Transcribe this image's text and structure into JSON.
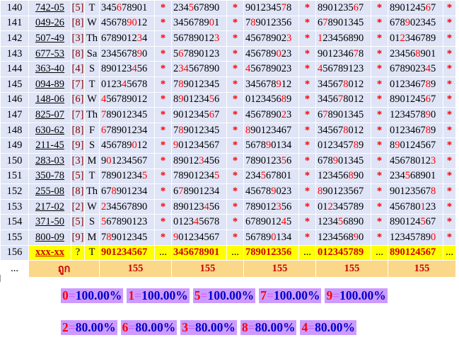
{
  "rows": [
    {
      "num": "140",
      "code": "742-05",
      "digit": "[5]",
      "day": "T",
      "cols": [
        "345678901",
        "234567890",
        "901234578",
        "890123567",
        "890124567"
      ]
    },
    {
      "num": "141",
      "code": "049-26",
      "digit": "[8]",
      "day": "W",
      "cols": [
        "456789012",
        "345678901",
        "789012356",
        "678901345",
        "678902345"
      ]
    },
    {
      "num": "142",
      "code": "507-49",
      "digit": "[3]",
      "day": "Th",
      "cols": [
        "678901234",
        "567890123",
        "456789023",
        "123456890",
        "012346789"
      ]
    },
    {
      "num": "143",
      "code": "677-53",
      "digit": "[8]",
      "day": "Sa",
      "cols": [
        "234567890",
        "567890123",
        "456789023",
        "901234678",
        "234568901"
      ]
    },
    {
      "num": "144",
      "code": "363-40",
      "digit": "[4]",
      "day": "S",
      "cols": [
        "890123456",
        "234567890",
        "456789023",
        "456789123",
        "678902345"
      ]
    },
    {
      "num": "145",
      "code": "094-89",
      "digit": "[7]",
      "day": "T",
      "cols": [
        "012345678",
        "789012345",
        "345678912",
        "345678012",
        "012346789"
      ]
    },
    {
      "num": "146",
      "code": "148-06",
      "digit": "[6]",
      "day": "W",
      "cols": [
        "456789012",
        "890123456",
        "012345689",
        "345678012",
        "890124567"
      ]
    },
    {
      "num": "147",
      "code": "825-07",
      "digit": "[7]",
      "day": "Th",
      "cols": [
        "789012345",
        "901234567",
        "456789023",
        "678901345",
        "123457890"
      ]
    },
    {
      "num": "148",
      "code": "630-62",
      "digit": "[8]",
      "day": "F",
      "cols": [
        "678901234",
        "789012345",
        "890123467",
        "345678012",
        "012346789"
      ]
    },
    {
      "num": "149",
      "code": "211-45",
      "digit": "[9]",
      "day": "S",
      "cols": [
        "456789012",
        "901234567",
        "567890134",
        "012345789",
        "890124567"
      ]
    },
    {
      "num": "150",
      "code": "283-03",
      "digit": "[3]",
      "day": "M",
      "cols": [
        "901234567",
        "890123456",
        "789012356",
        "678901345",
        "456780123"
      ]
    },
    {
      "num": "151",
      "code": "350-78",
      "digit": "[5]",
      "day": "T",
      "cols": [
        "789012345",
        "789012345",
        "234567801",
        "123456890",
        "234568901"
      ]
    },
    {
      "num": "152",
      "code": "255-08",
      "digit": "[8]",
      "day": "Th",
      "cols": [
        "678901234",
        "678901234",
        "456789023",
        "890123567",
        "901235678"
      ]
    },
    {
      "num": "153",
      "code": "217-02",
      "digit": "[2]",
      "day": "W",
      "cols": [
        "234567890",
        "890123456",
        "789012356",
        "012345789",
        "456780123"
      ]
    },
    {
      "num": "154",
      "code": "371-50",
      "digit": "[5]",
      "day": "S",
      "cols": [
        "567890123",
        "012345678",
        "678901245",
        "123456890",
        "890124567"
      ]
    },
    {
      "num": "155",
      "code": "800-09",
      "digit": "[9]",
      "day": "M",
      "cols": [
        "789012345",
        "901234567",
        "567890134",
        "123456890",
        "123457890"
      ]
    }
  ],
  "highlights": [
    [
      [
        3
      ],
      [
        3
      ],
      [
        7
      ],
      [
        7
      ],
      [
        7
      ]
    ],
    [
      [
        5,
        6
      ],
      [
        7
      ],
      [
        1
      ],
      [
        1
      ],
      [
        3
      ]
    ],
    [
      [
        7
      ],
      [
        8
      ],
      [
        8
      ],
      [
        0
      ],
      [
        2
      ]
    ],
    [
      [
        7
      ],
      [
        1
      ],
      [
        6
      ],
      [
        7
      ],
      [
        5
      ]
    ],
    [
      [
        6
      ],
      [
        1,
        2
      ],
      [
        0
      ],
      [
        0
      ],
      [
        7
      ]
    ],
    [
      [
        4
      ],
      [
        1
      ],
      [
        6
      ],
      [
        5
      ],
      [
        7
      ]
    ],
    [
      [
        0
      ],
      [
        1,
        7
      ],
      [
        7
      ],
      [
        4
      ],
      [
        7
      ]
    ],
    [
      [
        0
      ],
      [
        7
      ],
      [
        7
      ],
      [
        1
      ],
      [
        7
      ]
    ],
    [
      [
        0
      ],
      [
        1
      ],
      [
        0
      ],
      [
        5
      ],
      [
        7
      ]
    ],
    [
      [
        6
      ],
      [
        0
      ],
      [
        4
      ],
      [
        7
      ],
      [
        1
      ]
    ],
    [
      [
        1
      ],
      [
        5
      ],
      [
        7
      ],
      [
        3
      ],
      [
        8
      ]
    ],
    [
      [
        8
      ],
      [
        8
      ],
      [
        3
      ],
      [
        6
      ],
      [
        3
      ]
    ],
    [
      [
        2
      ],
      [
        1
      ],
      [
        5
      ],
      [
        0
      ],
      [
        8
      ]
    ],
    [
      [
        0
      ],
      [
        6
      ],
      [
        6
      ],
      [
        2
      ],
      [
        6
      ]
    ],
    [
      [
        0
      ],
      [
        4
      ],
      [
        7
      ],
      [
        4
      ],
      [
        6
      ]
    ],
    [
      [
        1
      ],
      [
        0
      ],
      [
        5
      ],
      [
        7
      ],
      [
        8
      ]
    ]
  ],
  "footer": {
    "num": "156",
    "code": "xxx-xx",
    "digit": "?",
    "day": "T",
    "dots": "...",
    "cols": [
      "901234567",
      "345678901",
      "789012356",
      "012345789",
      "890124567"
    ]
  },
  "summary": {
    "dots": "...",
    "label": "ถูก",
    "values": [
      "155",
      "155",
      "155",
      "155",
      "155"
    ]
  },
  "star": "*",
  "stats_row1": [
    {
      "k": "0",
      "p": "100.00%"
    },
    {
      "k": "1",
      "p": "100.00%"
    },
    {
      "k": "5",
      "p": "100.00%"
    },
    {
      "k": "7",
      "p": "100.00%"
    },
    {
      "k": "9",
      "p": "100.00%"
    }
  ],
  "stats_row2": [
    {
      "k": "2",
      "p": "80.00%"
    },
    {
      "k": "6",
      "p": "80.00%"
    },
    {
      "k": "3",
      "p": "80.00%"
    },
    {
      "k": "8",
      "p": "80.00%"
    },
    {
      "k": "4",
      "p": "80.00%"
    }
  ],
  "equals": "="
}
